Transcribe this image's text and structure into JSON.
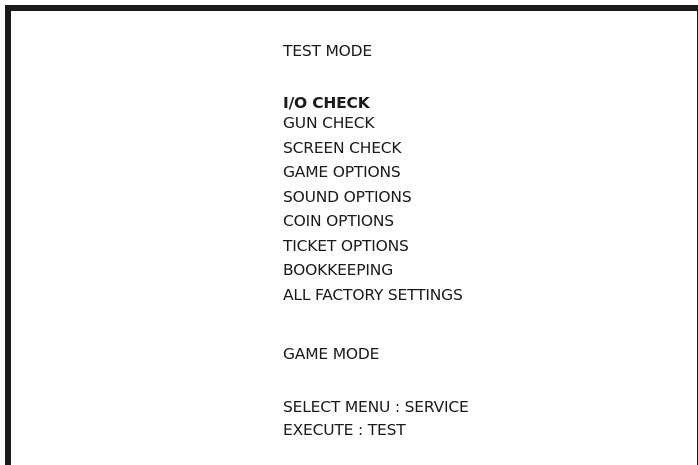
{
  "title": "TEST MODE",
  "menu_items": [
    {
      "label": "I/O CHECK",
      "selected": true
    },
    {
      "label": "GUN CHECK",
      "selected": false
    },
    {
      "label": "SCREEN CHECK",
      "selected": false
    },
    {
      "label": "GAME OPTIONS",
      "selected": false
    },
    {
      "label": "SOUND OPTIONS",
      "selected": false
    },
    {
      "label": "COIN OPTIONS",
      "selected": false
    },
    {
      "label": "TICKET OPTIONS",
      "selected": false
    },
    {
      "label": "BOOKKEEPING",
      "selected": false
    },
    {
      "label": "ALL FACTORY SETTINGS",
      "selected": false
    }
  ],
  "game_mode_label": "GAME MODE",
  "instructions": {
    "select": "SELECT MENU : SERVICE",
    "execute": "EXECUTE : TEST"
  }
}
